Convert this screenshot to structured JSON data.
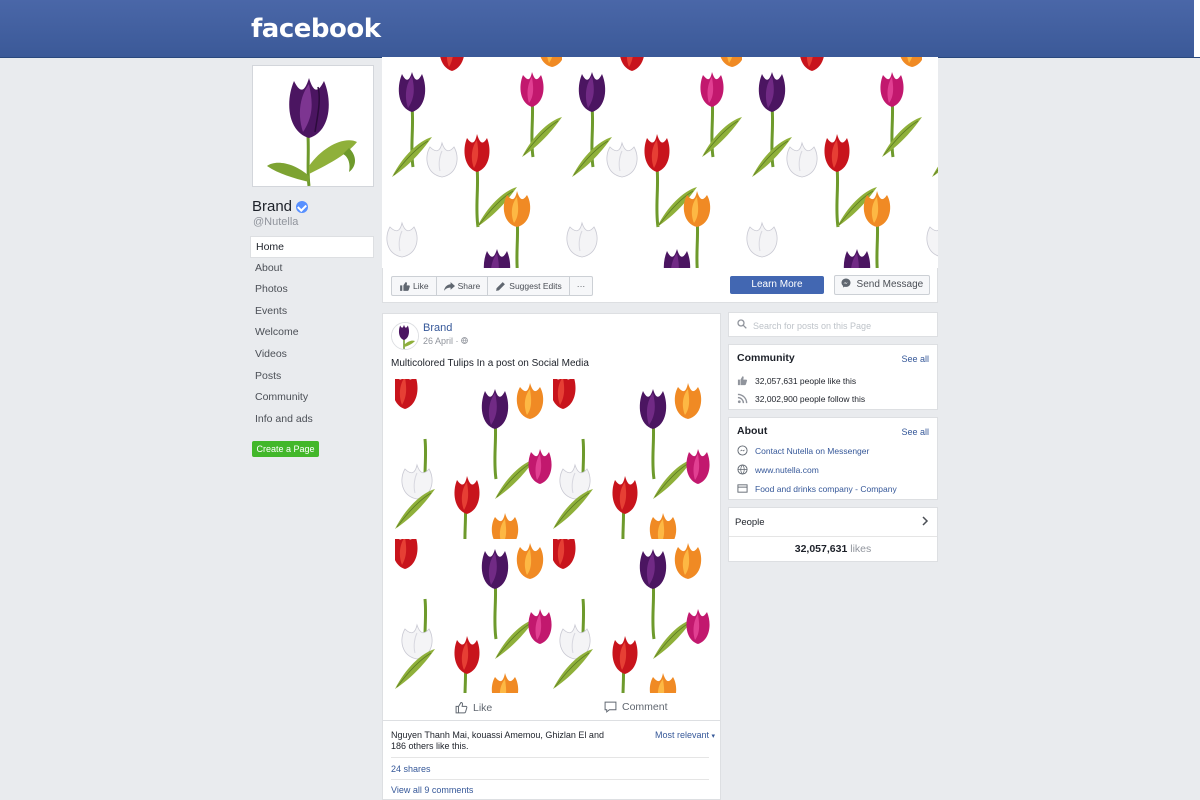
{
  "brand": {
    "logo_text": "facebook"
  },
  "profile": {
    "name": "Brand",
    "handle": "@Nutella"
  },
  "nav": {
    "items": [
      "Home",
      "About",
      "Photos",
      "Events",
      "Welcome",
      "Videos",
      "Posts",
      "Community",
      "Info and ads"
    ],
    "active": "Home",
    "create_page": "Create a Page"
  },
  "actions": {
    "like": "Like",
    "share": "Share",
    "suggest_edits": "Suggest Edits",
    "more": "···",
    "learn_more": "Learn More",
    "send_message": "Send Message"
  },
  "post": {
    "author": "Brand",
    "date": "26 April ·",
    "text": "Multicolored Tulips In a post on Social Media",
    "like_label": "Like",
    "comment_label": "Comment",
    "likers": "Nguyen Thanh Mai, kouassi Amemou, Ghizlan El and 186 others like this.",
    "sort_label": "Most relevant",
    "shares": "24 shares",
    "view_comments": "View all 9 comments"
  },
  "sidebar": {
    "search_placeholder": "Search for posts on this Page",
    "community": {
      "title": "Community",
      "see_all": "See all",
      "likes_text": "32,057,631 people like this",
      "follows_text": "32,002,900 people follow this"
    },
    "about": {
      "title": "About",
      "see_all": "See all",
      "messenger": "Contact Nutella on Messenger",
      "website": "www.nutella.com",
      "category": "Food and drinks company - Company"
    },
    "people": {
      "title": "People",
      "count": "32,057,631",
      "count_label": "likes"
    }
  },
  "colors": {
    "header_blue": "#3b5998",
    "button_blue": "#4267b2",
    "link_blue": "#365899",
    "create_green": "#42b72a",
    "background": "#e9ebee"
  },
  "icons": [
    "verified-badge-icon",
    "like-icon",
    "share-icon",
    "edit-icon",
    "messenger-icon",
    "search-icon",
    "thumb-icon",
    "rss-icon",
    "globe-icon",
    "category-icon",
    "chevron-right-icon",
    "comment-icon",
    "globe-small-icon"
  ]
}
